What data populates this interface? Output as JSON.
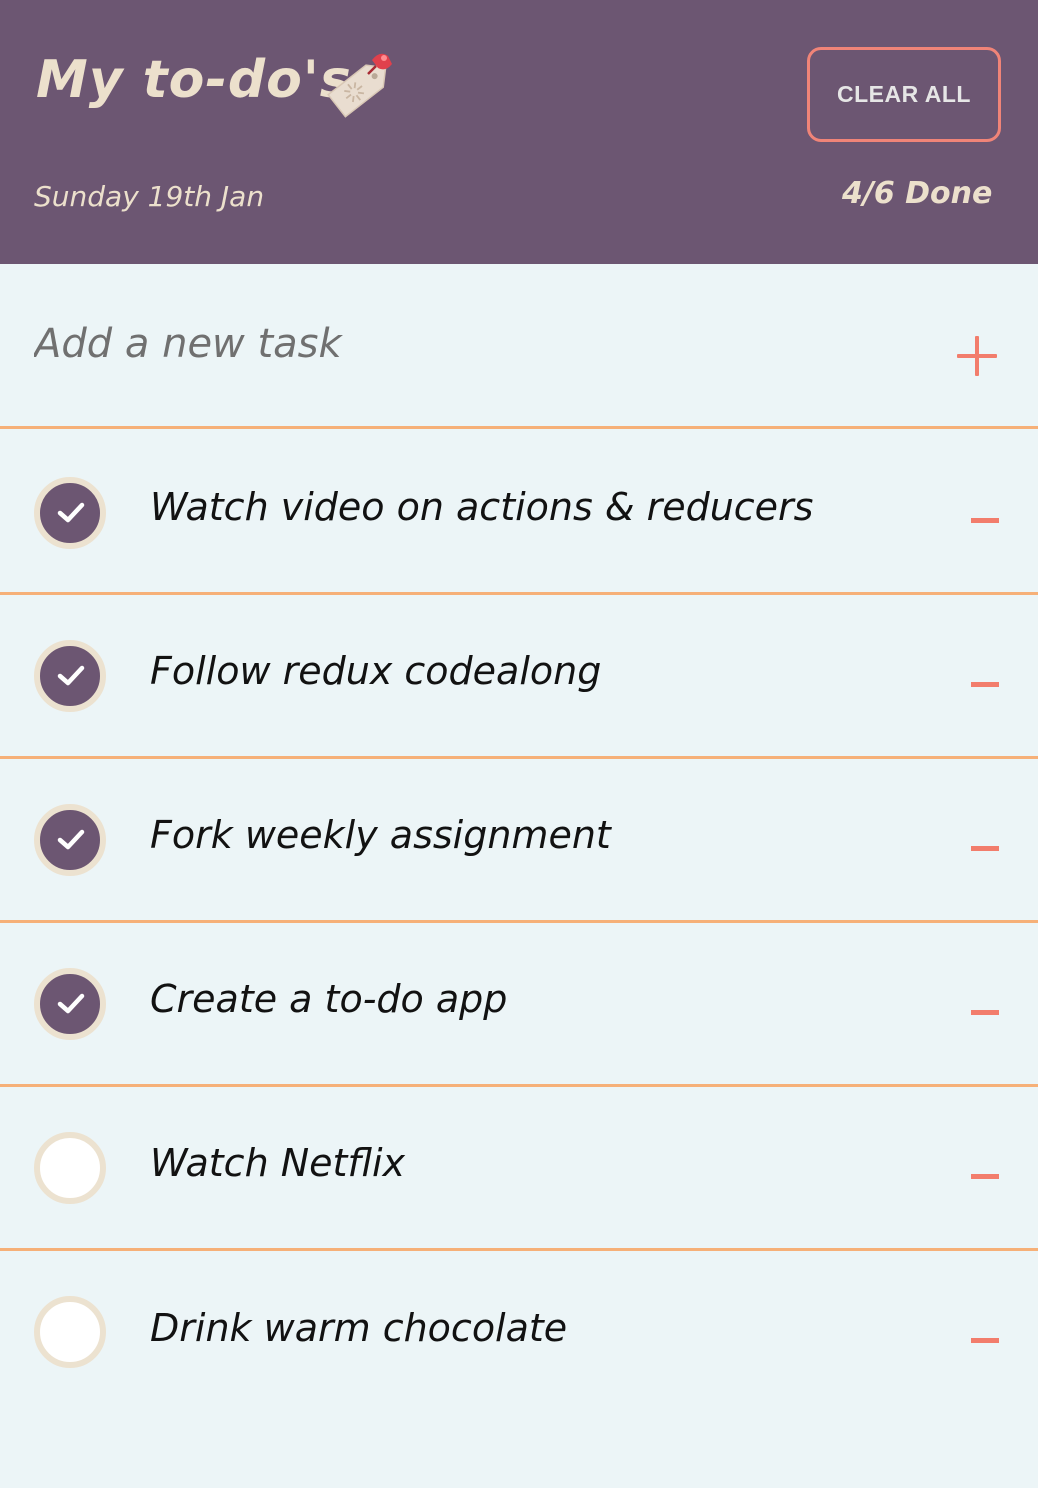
{
  "header": {
    "title": "My to-do's",
    "date": "Sunday 19th Jan",
    "done_count": "4/6 Done",
    "clear_label": "CLEAR ALL"
  },
  "add_task": {
    "placeholder": "Add a new task",
    "add_icon": "plus-icon"
  },
  "tasks": [
    {
      "text": "Watch video on actions & reducers",
      "done": true
    },
    {
      "text": "Follow redux codealong",
      "done": true
    },
    {
      "text": "Fork weekly assignment",
      "done": true
    },
    {
      "text": "Create a to-do app",
      "done": true
    },
    {
      "text": "Watch Netflix",
      "done": false
    },
    {
      "text": "Drink warm chocolate",
      "done": false
    }
  ],
  "colors": {
    "header_bg": "#6c5672",
    "header_text": "#ece0cc",
    "page_bg": "#ecf5f7",
    "accent": "#f27d6c",
    "divider": "#f6b078",
    "check_done": "#6c5672"
  }
}
